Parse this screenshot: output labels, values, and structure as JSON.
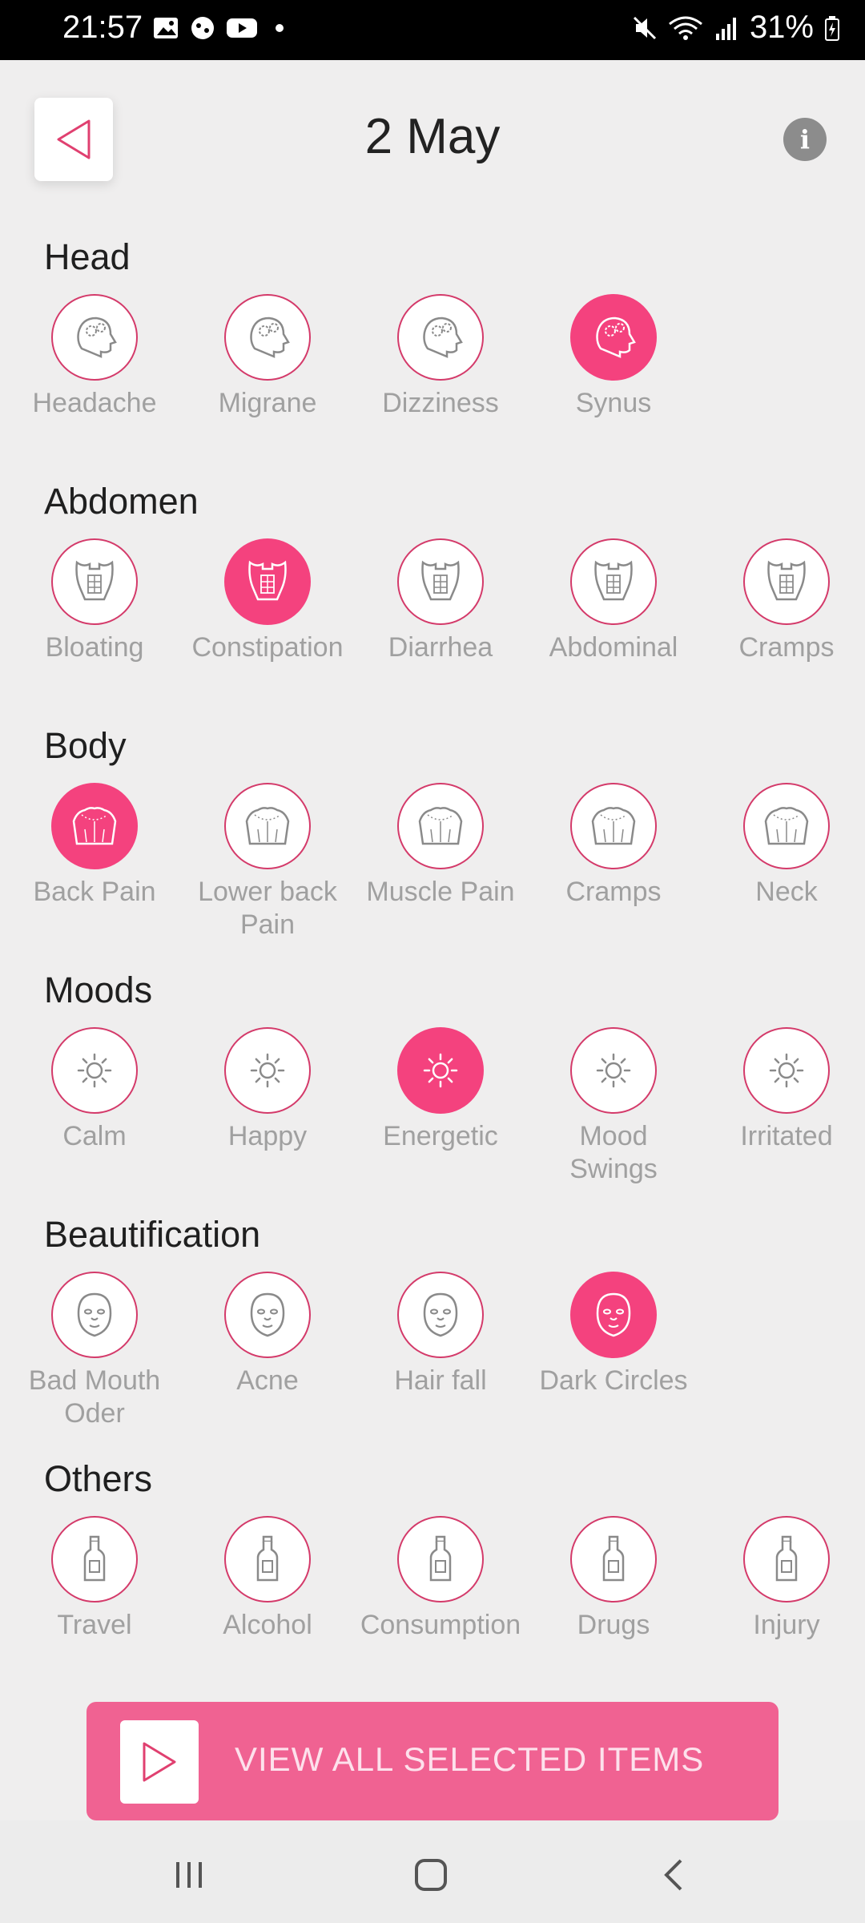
{
  "status": {
    "time": "21:57",
    "battery": "31%"
  },
  "header": {
    "title": "2 May",
    "info_label": "i"
  },
  "sections": [
    {
      "title": "Head",
      "icon": "head-gears-icon",
      "items": [
        {
          "label": "Headache",
          "selected": false
        },
        {
          "label": "Migrane",
          "selected": false
        },
        {
          "label": "Dizziness",
          "selected": false
        },
        {
          "label": "Synus",
          "selected": true
        }
      ]
    },
    {
      "title": "Abdomen",
      "icon": "abdomen-icon",
      "items": [
        {
          "label": "Bloating",
          "selected": false
        },
        {
          "label": "Constipation",
          "selected": true
        },
        {
          "label": "Diarrhea",
          "selected": false
        },
        {
          "label": "Abdominal",
          "selected": false
        },
        {
          "label": "Cramps",
          "selected": false
        }
      ]
    },
    {
      "title": "Body",
      "icon": "back-icon",
      "items": [
        {
          "label": "Back Pain",
          "selected": true
        },
        {
          "label": "Lower back Pain",
          "selected": false
        },
        {
          "label": "Muscle Pain",
          "selected": false
        },
        {
          "label": "Cramps",
          "selected": false
        },
        {
          "label": "Neck",
          "selected": false
        }
      ]
    },
    {
      "title": "Moods",
      "icon": "sun-icon",
      "items": [
        {
          "label": "Calm",
          "selected": false
        },
        {
          "label": "Happy",
          "selected": false
        },
        {
          "label": "Energetic",
          "selected": true
        },
        {
          "label": "Mood Swings",
          "selected": false
        },
        {
          "label": "Irritated",
          "selected": false
        }
      ]
    },
    {
      "title": "Beautification",
      "icon": "face-icon",
      "items": [
        {
          "label": "Bad Mouth Oder",
          "selected": false
        },
        {
          "label": "Acne",
          "selected": false
        },
        {
          "label": "Hair fall",
          "selected": false
        },
        {
          "label": "Dark Circles",
          "selected": true
        }
      ]
    },
    {
      "title": "Others",
      "icon": "bottle-icon",
      "items": [
        {
          "label": "Travel",
          "selected": false
        },
        {
          "label": "Alcohol",
          "selected": false
        },
        {
          "label": "Consumption",
          "selected": false
        },
        {
          "label": "Drugs",
          "selected": false
        },
        {
          "label": "Injury",
          "selected": false
        }
      ]
    }
  ],
  "cta": {
    "label": "VIEW ALL SELECTED ITEMS"
  },
  "colors": {
    "accent": "#f4427e",
    "outline": "#d43a6a",
    "cta": "#f06292"
  }
}
